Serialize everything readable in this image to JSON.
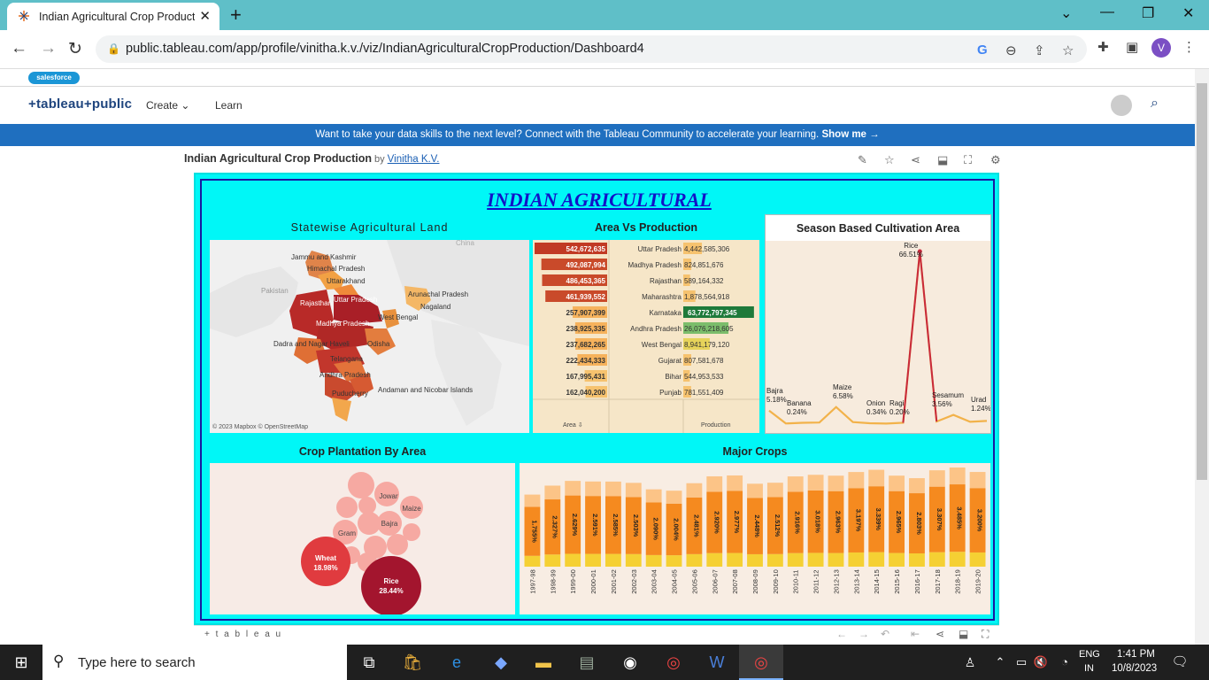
{
  "browser": {
    "tab_title": "Indian Agricultural Crop Product",
    "new_tab": "+",
    "url": "public.tableau.com/app/profile/vinitha.k.v./viz/IndianAgriculturalCropProduction/Dashboard4",
    "profile_initial": "V"
  },
  "salesforce": {
    "label": "salesforce"
  },
  "tableau_nav": {
    "brand": "+tableau+public",
    "create": "Create",
    "learn": "Learn"
  },
  "banner": {
    "text": "Want to take your data skills to the next level? Connect with the Tableau Community to accelerate your learning.",
    "link": "Show me →"
  },
  "viz": {
    "title": "Indian Agricultural Crop Production",
    "by": "by",
    "author": "Vinitha K.V."
  },
  "dashboard": {
    "title": "INDIAN AGRICULTURAL",
    "map_title": "Statewise Agricultural Land",
    "avp_title": "Area Vs Production",
    "season_title": "Season Based Cultivation Area",
    "crop_title": "Crop Plantation By Area",
    "major_title": "Major Crops",
    "map_credit": "© 2023 Mapbox © OpenStreetMap",
    "map_labels": [
      "China",
      "Jammu and Kashmir",
      "Himachal Pradesh",
      "Uttarakhand",
      "Pakistan",
      "Rajasthan",
      "Uttar Pradesh",
      "Arunachal Pradesh",
      "Nagaland",
      "West Bengal",
      "Madhya Pradesh",
      "Dadra and Nagar Haveli",
      "Odisha",
      "Telangana",
      "Andhra Pradesh",
      "Puducherry",
      "Andaman and Nicobar Islands"
    ],
    "avp": {
      "area_header": "Area",
      "production_header": "Production",
      "rows": [
        {
          "area": "542,672,635",
          "state": "Uttar Pradesh",
          "production": "4,442,585,306"
        },
        {
          "area": "492,087,994",
          "state": "Madhya Pradesh",
          "production": "824,851,676"
        },
        {
          "area": "486,453,365",
          "state": "Rajasthan",
          "production": "589,164,332"
        },
        {
          "area": "461,939,552",
          "state": "Maharashtra",
          "production": "1,878,564,918"
        },
        {
          "area": "257,907,399",
          "state": "Karnataka",
          "production": "63,772,797,345"
        },
        {
          "area": "238,925,335",
          "state": "Andhra Pradesh",
          "production": "26,076,218,605"
        },
        {
          "area": "237,682,265",
          "state": "West Bengal",
          "production": "8,941,179,120"
        },
        {
          "area": "222,434,333",
          "state": "Gujarat",
          "production": "807,581,678"
        },
        {
          "area": "167,995,431",
          "state": "Bihar",
          "production": "544,953,533"
        },
        {
          "area": "162,040,200",
          "state": "Punjab",
          "production": "781,551,409"
        }
      ]
    },
    "crop_bubbles": [
      {
        "label": "Wheat",
        "value": "18.98%"
      },
      {
        "label": "Rice",
        "value": "28.44%"
      },
      {
        "label": "Jowar",
        "value": ""
      },
      {
        "label": "Maize",
        "value": ""
      },
      {
        "label": "Bajra",
        "value": ""
      },
      {
        "label": "Gram",
        "value": ""
      }
    ],
    "tableau_footer": "+ t a b l e a u"
  },
  "chart_data": [
    {
      "type": "line",
      "title": "Season Based Cultivation Area",
      "categories": [
        "Bajra",
        "Banana",
        "",
        "",
        "Maize",
        "",
        "Onion",
        "Ragi",
        "",
        "Rice",
        "",
        "Sesamum",
        "",
        "Urad"
      ],
      "values": [
        5.18,
        0.24,
        0.5,
        0.6,
        6.58,
        0.8,
        0.34,
        0.2,
        0.5,
        66.51,
        1.0,
        3.56,
        0.9,
        1.24
      ],
      "labels": [
        {
          "name": "Rice",
          "value": "66.51%"
        },
        {
          "name": "Bajra",
          "value": "5.18%"
        },
        {
          "name": "Banana",
          "value": "0.24%"
        },
        {
          "name": "Maize",
          "value": "6.58%"
        },
        {
          "name": "Onion",
          "value": "0.34%"
        },
        {
          "name": "Ragi",
          "value": "0.20%"
        },
        {
          "name": "Sesamum",
          "value": "3.56%"
        },
        {
          "name": "Urad",
          "value": "1.24%"
        }
      ]
    },
    {
      "type": "bar",
      "title": "Major Crops",
      "categories": [
        "1997-98",
        "1998-99",
        "1999-00",
        "2000-01",
        "2001-02",
        "2002-03",
        "2003-04",
        "2004-05",
        "2005-06",
        "2006-07",
        "2007-08",
        "2008-09",
        "2009-10",
        "2010-11",
        "2011-12",
        "2012-13",
        "2013-14",
        "2014-15",
        "2015-16",
        "2016-17",
        "2017-18",
        "2018-19",
        "2019-20"
      ],
      "values": [
        1.755,
        2.327,
        2.629,
        2.591,
        2.585,
        2.503,
        2.09,
        2.004,
        2.481,
        2.92,
        2.977,
        2.448,
        2.512,
        2.916,
        3.018,
        2.963,
        3.197,
        3.339,
        2.965,
        2.803,
        3.307,
        3.485,
        3.2
      ],
      "bar_labels": [
        "1.755%",
        "2.327%",
        "2.629%",
        "2.591%",
        "2.585%",
        "2.503%",
        "2.090%",
        "2.004%",
        "2.481%",
        "2.920%",
        "2.977%",
        "2.448%",
        "2.512%",
        "2.916%",
        "3.018%",
        "2.963%",
        "3.197%",
        "3.339%",
        "2.965%",
        "2.803%",
        "3.307%",
        "3.485%",
        "3.200%"
      ],
      "colors": {
        "bottom": "#f5d033",
        "middle": "#f58a1f",
        "top": "#fcc487"
      }
    }
  ],
  "taskbar": {
    "search_placeholder": "Type here to search",
    "lang": "ENG",
    "region": "IN",
    "time": "1:41 PM",
    "date": "10/8/2023"
  },
  "colors": {
    "dashboard_bg": "#00f7f7",
    "banner": "#1f6fbf",
    "title": "#1212c8"
  }
}
